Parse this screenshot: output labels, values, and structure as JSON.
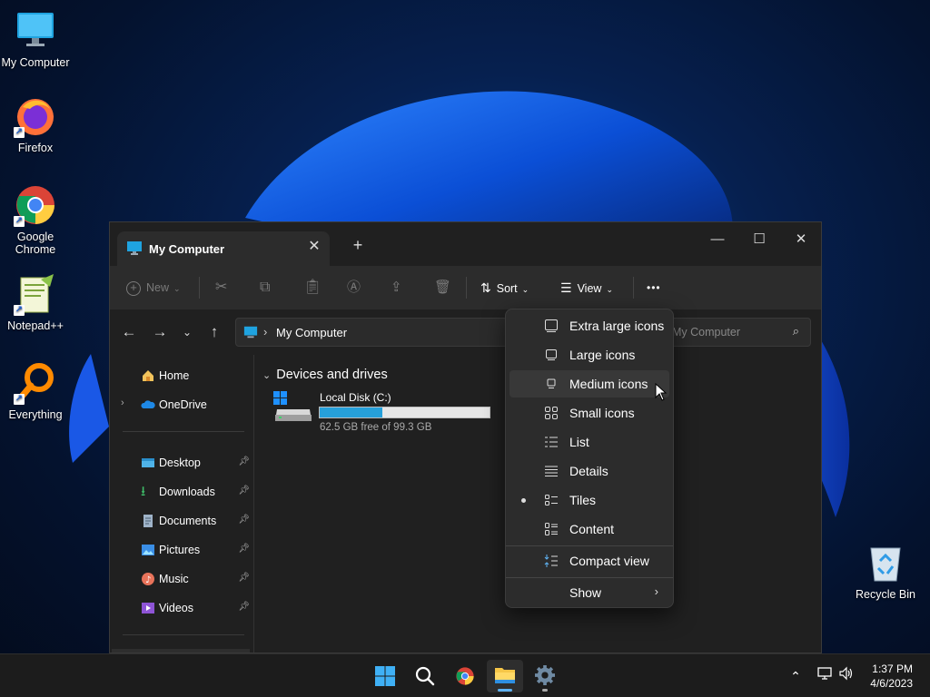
{
  "desktop": {
    "icons": [
      {
        "label": "My Computer"
      },
      {
        "label": "Firefox"
      },
      {
        "label": "Google Chrome"
      },
      {
        "label": "Notepad++"
      },
      {
        "label": "Everything"
      },
      {
        "label": "Recycle Bin"
      }
    ]
  },
  "window": {
    "tab_title": "My Computer",
    "new_tab": "+",
    "controls": {
      "minimize": "—",
      "maximize": "☐",
      "close": "✕"
    }
  },
  "toolbar": {
    "new_label": "New",
    "sort_label": "Sort",
    "view_label": "View",
    "more_label": "•••"
  },
  "address": {
    "breadcrumb": "My Computer",
    "separator": "›",
    "search_placeholder": "Search My Computer",
    "search_visible": "My Computer"
  },
  "nav": {
    "items": [
      {
        "label": "Home"
      },
      {
        "label": "OneDrive"
      },
      {
        "label": "Desktop"
      },
      {
        "label": "Downloads"
      },
      {
        "label": "Documents"
      },
      {
        "label": "Pictures"
      },
      {
        "label": "Music"
      },
      {
        "label": "Videos"
      }
    ]
  },
  "content": {
    "group_header": "Devices and drives",
    "drive": {
      "name": "Local Disk (C:)",
      "free_text": "62.5 GB free of 99.3 GB",
      "used_fraction": 0.37
    }
  },
  "view_menu": {
    "items": [
      {
        "label": "Extra large icons"
      },
      {
        "label": "Large icons"
      },
      {
        "label": "Medium icons",
        "hovered": true
      },
      {
        "label": "Small icons"
      },
      {
        "label": "List"
      },
      {
        "label": "Details"
      },
      {
        "label": "Tiles",
        "selected": true
      },
      {
        "label": "Content"
      },
      {
        "label": "Compact view"
      },
      {
        "label": "Show"
      }
    ]
  },
  "taskbar": {
    "time": "1:37 PM",
    "date": "4/6/2023"
  },
  "colors": {
    "accent": "#26a0da",
    "window_bg": "#202020",
    "toolbar_bg": "#2c2c2c"
  }
}
